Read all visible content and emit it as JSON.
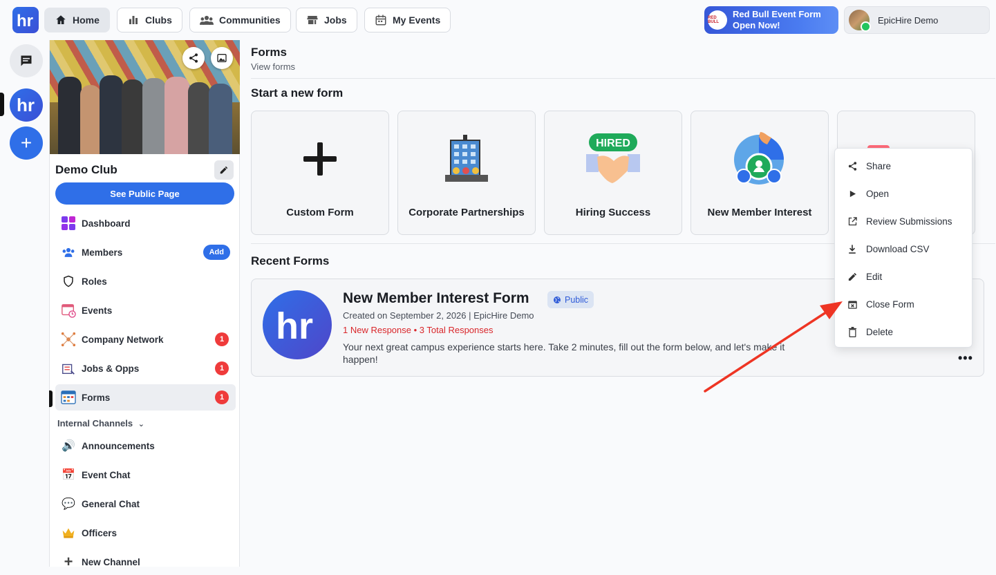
{
  "nav": {
    "items": [
      {
        "label": "Home",
        "icon": "home-icon"
      },
      {
        "label": "Clubs",
        "icon": "bar-chart-icon"
      },
      {
        "label": "Communities",
        "icon": "people-icon"
      },
      {
        "label": "Jobs",
        "icon": "store-icon"
      },
      {
        "label": "My Events",
        "icon": "calendar-icon"
      }
    ],
    "promo": {
      "line1": "Red Bull Event Form",
      "line2": "Open Now!"
    },
    "profile_name": "EpicHire Demo"
  },
  "club": {
    "name": "Demo Club",
    "public_button": "See Public Page",
    "menu": [
      {
        "label": "Dashboard",
        "icon": "dashboard-icon"
      },
      {
        "label": "Members",
        "icon": "members-icon",
        "action": "Add"
      },
      {
        "label": "Roles",
        "icon": "shield-icon"
      },
      {
        "label": "Events",
        "icon": "calendar-icon"
      },
      {
        "label": "Company Network",
        "icon": "network-icon",
        "count": "1"
      },
      {
        "label": "Jobs & Opps",
        "icon": "jobs-icon",
        "count": "1"
      },
      {
        "label": "Forms",
        "icon": "forms-icon",
        "count": "1"
      }
    ],
    "internal_channels_label": "Internal Channels",
    "channels": [
      {
        "label": "Announcements",
        "icon": "speaker-icon"
      },
      {
        "label": "Event Chat",
        "icon": "calendar-icon"
      },
      {
        "label": "General Chat",
        "icon": "speech-bubble-icon"
      },
      {
        "label": "Officers",
        "icon": "crown-icon"
      },
      {
        "label": "New Channel",
        "icon": "plus-icon"
      }
    ]
  },
  "forms": {
    "title": "Forms",
    "subtitle": "View forms",
    "start_heading": "Start a new form",
    "templates": [
      {
        "label": "Custom Form",
        "icon": "plus-icon"
      },
      {
        "label": "Corporate Partnerships",
        "icon": "building-icon"
      },
      {
        "label": "Hiring Success",
        "icon": "handshake-icon"
      },
      {
        "label": "New Member Interest",
        "icon": "member-icon"
      }
    ],
    "recent_heading": "Recent Forms",
    "recent": {
      "title": "New Member Interest Form",
      "visibility": "Public",
      "meta": "Created on September 2, 2026 | EpicHire Demo",
      "responses": "1 New Response • 3 Total Responses",
      "description": "Your next great campus experience starts here. Take 2 minutes, fill out the form below, and let's make it happen!"
    },
    "context_menu": [
      {
        "label": "Share",
        "icon": "share-icon"
      },
      {
        "label": "Open",
        "icon": "play-icon"
      },
      {
        "label": "Review Submissions",
        "icon": "external-link-icon"
      },
      {
        "label": "Download CSV",
        "icon": "download-icon"
      },
      {
        "label": "Edit",
        "icon": "pencil-icon"
      },
      {
        "label": "Close Form",
        "icon": "calendar-close-icon"
      },
      {
        "label": "Delete",
        "icon": "trash-icon"
      }
    ]
  },
  "colors": {
    "accent": "#2f6fe8",
    "badge": "#ef3b3b",
    "arrow": "#ee3524"
  }
}
